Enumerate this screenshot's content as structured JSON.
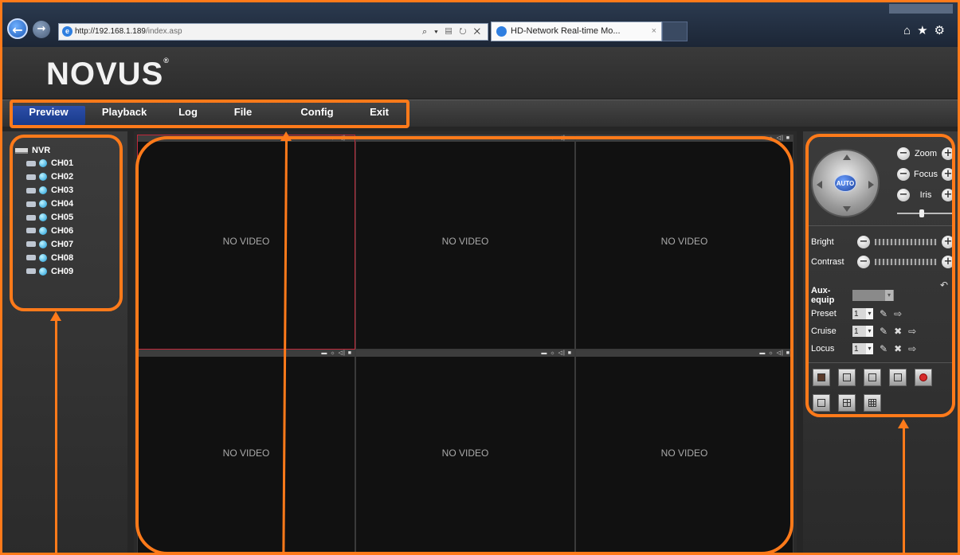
{
  "browser": {
    "url_host": "http://192.168.1.189",
    "url_path": "/index.asp",
    "address_tools": "⌕ ▾ ▤ ↻ ✕",
    "tab_title": "HD-Network Real-time Mo...",
    "tab_close": "×",
    "back_icon": "←",
    "forward_icon": "→",
    "toolbar_icons": "⌂★⚙"
  },
  "app": {
    "logo_text": "NOVUS",
    "logo_mark": "®"
  },
  "menu": {
    "items": [
      "Preview",
      "Playback",
      "Log",
      "File",
      "Config",
      "Exit"
    ],
    "active": "Preview"
  },
  "device_tree": {
    "root": "NVR",
    "channels": [
      "CH01",
      "CH02",
      "CH03",
      "CH04",
      "CH05",
      "CH06",
      "CH07",
      "CH08",
      "CH09"
    ]
  },
  "video": {
    "no_video_text": "NO VIDEO",
    "cell_status_icons": "▬ ☼ ◁| ■",
    "selected_cell": 1
  },
  "ptz": {
    "auto_label": "AUTO",
    "zoom_label": "Zoom",
    "focus_label": "Focus",
    "iris_label": "Iris",
    "minus": "−",
    "plus": "+"
  },
  "adjust": {
    "bright_label": "Bright",
    "contrast_label": "Contrast",
    "reset_icon": "↶"
  },
  "aux": {
    "aux_equip_label": "Aux-equip",
    "preset_label": "Preset",
    "cruise_label": "Cruise",
    "locus_label": "Locus",
    "preset_value": "1",
    "cruise_value": "1",
    "locus_value": "1",
    "edit_icon": "✎",
    "delete_icon": "✖",
    "go_icon": "⇨"
  },
  "colors": {
    "annotation": "#ff7a1a",
    "menu_active": "#1f46a0",
    "selected_cell_border": "#c0283a"
  }
}
